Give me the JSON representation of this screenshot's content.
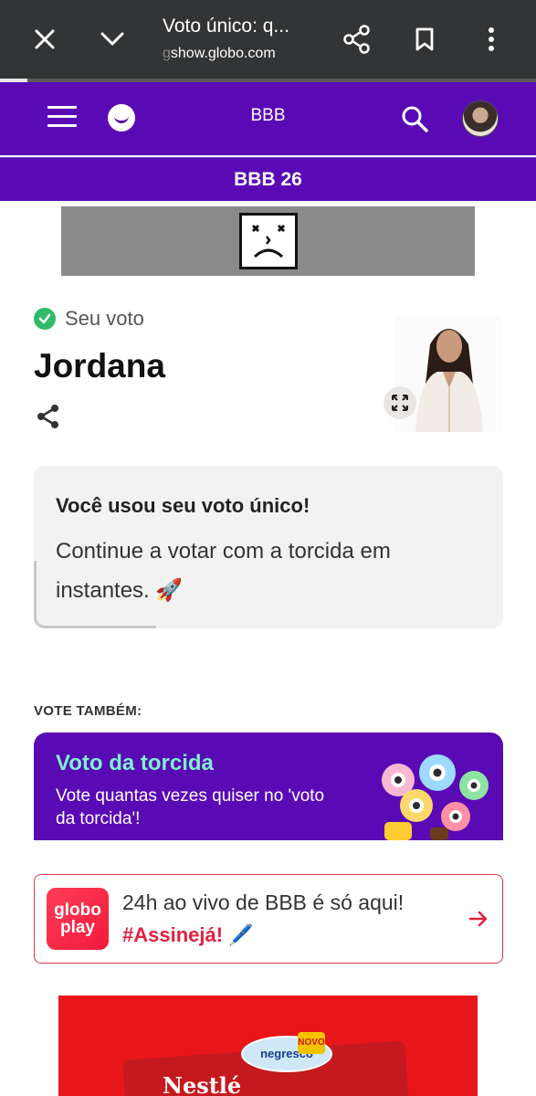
{
  "browser": {
    "title": "Voto único: q...",
    "domain_prefix": "g",
    "domain": "show.globo.com"
  },
  "header": {
    "title": "BBB",
    "subtitle": "BBB 26"
  },
  "vote": {
    "status_label": "Seu voto",
    "candidate": "Jordana"
  },
  "notice": {
    "heading": "Você usou seu voto único!",
    "body": "Continue a votar com a torcida em instantes. 🚀"
  },
  "vote_also": {
    "label": "VOTE TAMBÉM:",
    "card_title": "Voto da torcida",
    "card_desc": "Vote quantas vezes quiser no 'voto da torcida'!"
  },
  "globoplay": {
    "logo_line1": "globo",
    "logo_line2": "play",
    "line1": "24h ao vivo de BBB é só aqui!",
    "line2": "#Assinejá! 🖊️"
  },
  "bottom_ad": {
    "brand": "Nestlé",
    "product": "negresco",
    "badge": "NOVO"
  },
  "colors": {
    "brand_purple": "#5a0ab5",
    "accent_mint": "#7ef0cf",
    "globoplay_red": "#e0223f",
    "success_green": "#2fbb6a"
  },
  "icons": {
    "close": "close-icon",
    "collapse": "chevron-down-icon",
    "share": "share-icon",
    "bookmark": "bookmark-icon",
    "more": "more-vert-icon",
    "menu": "hamburger-icon",
    "search": "search-icon",
    "check": "check-circle-icon",
    "expand": "expand-icon",
    "arrow": "arrow-right-icon"
  }
}
